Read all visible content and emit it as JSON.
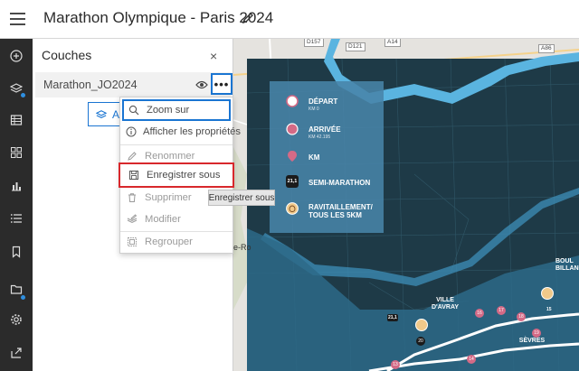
{
  "header": {
    "title": "Marathon Olympique - Paris 2024",
    "menu_icon": "hamburger-icon",
    "edit_icon": "pencil-icon"
  },
  "actionbar": {
    "items": [
      "add-icon",
      "layers-icon",
      "table-icon",
      "widgets-icon",
      "chart-icon",
      "list-icon",
      "bookmark-icon",
      "folder-icon",
      "settings-icon",
      "share-icon"
    ]
  },
  "panel": {
    "title": "Couches",
    "close": "×",
    "layer": {
      "name": "Marathon_JO2024",
      "more": "•••"
    },
    "add_button": "A"
  },
  "menu": {
    "items": [
      {
        "label": "Zoom sur",
        "icon": "zoom-icon",
        "enabled": true
      },
      {
        "label": "Afficher les propriétés",
        "icon": "info-icon",
        "enabled": true
      },
      {
        "label": "Renommer",
        "icon": "pencil-icon",
        "enabled": false
      },
      {
        "label": "Enregistrer sous",
        "icon": "save-icon",
        "enabled": true
      },
      {
        "label": "Supprimer",
        "icon": "trash-icon",
        "enabled": false
      },
      {
        "label": "Modifier",
        "icon": "edit-layers-icon",
        "enabled": false
      },
      {
        "label": "Regrouper",
        "icon": "group-icon",
        "enabled": false
      }
    ]
  },
  "tooltip": "Enregistrer sous",
  "map": {
    "roads": [
      "D157",
      "D121",
      "A14",
      "A86"
    ],
    "legend": [
      {
        "label": "DÉPART",
        "sub": "KM 0"
      },
      {
        "label": "ARRIVÉE",
        "sub": "KM 42.195"
      },
      {
        "label": "KM",
        "sub": ""
      },
      {
        "label": "SEMI-MARATHON",
        "sub": ""
      },
      {
        "label": "RAVITAILLEMENT/ TOUS LES 5KM",
        "sub": ""
      }
    ],
    "semi_badge": "21,1",
    "places": [
      "VILLE D'AVRAY",
      "SÈVRES",
      "BOUL BILLANC"
    ],
    "side_text": "e-Ro",
    "km_markers": [
      "21,1",
      "15",
      "16",
      "17",
      "18",
      "19",
      "20",
      "13",
      "14"
    ],
    "colors": {
      "water": "#5ab4e0",
      "dark": "#1e3a47",
      "route": "#ffffff",
      "pin": "#d46a86"
    }
  }
}
